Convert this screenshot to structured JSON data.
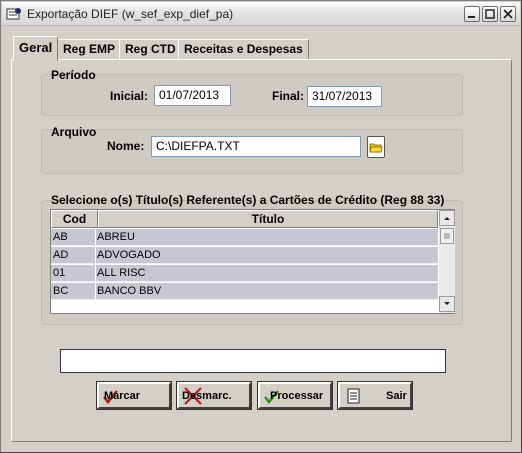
{
  "window": {
    "title": "Exportação DIEF (w_sef_exp_dief_pa)"
  },
  "tabs": [
    "Geral",
    "Reg EMP",
    "Reg CTD",
    "Receitas e Despesas"
  ],
  "periodo": {
    "group_title": "Período",
    "inicial_label": "Inicial:",
    "inicial_value": "01/07/2013",
    "final_label": "Final:",
    "final_value": "31/07/2013"
  },
  "arquivo": {
    "group_title": "Arquivo",
    "nome_label": "Nome:",
    "nome_value": "C:\\DIEFPA.TXT"
  },
  "cartoes": {
    "group_title": "Selecione o(s) Título(s) Referente(s) a Cartões de Crédito (Reg 88 33)",
    "columns": [
      "Cod",
      "Título"
    ],
    "rows": [
      {
        "cod": "AB",
        "titulo": "ABREU"
      },
      {
        "cod": "AD",
        "titulo": "ADVOGADO"
      },
      {
        "cod": "01",
        "titulo": "ALL RISC"
      },
      {
        "cod": "BC",
        "titulo": "BANCO BBV"
      }
    ]
  },
  "status": {
    "value": ""
  },
  "buttons": {
    "marcar": "Marcar",
    "desmarcar": "Desmarc.",
    "processar": "Processar",
    "sair": "Sair"
  },
  "icons": {
    "app": "app-icon",
    "browse": "folder-icon",
    "marcar": "check-icon",
    "desmarcar": "x-icon",
    "processar": "process-icon",
    "sair": "exit-icon"
  }
}
